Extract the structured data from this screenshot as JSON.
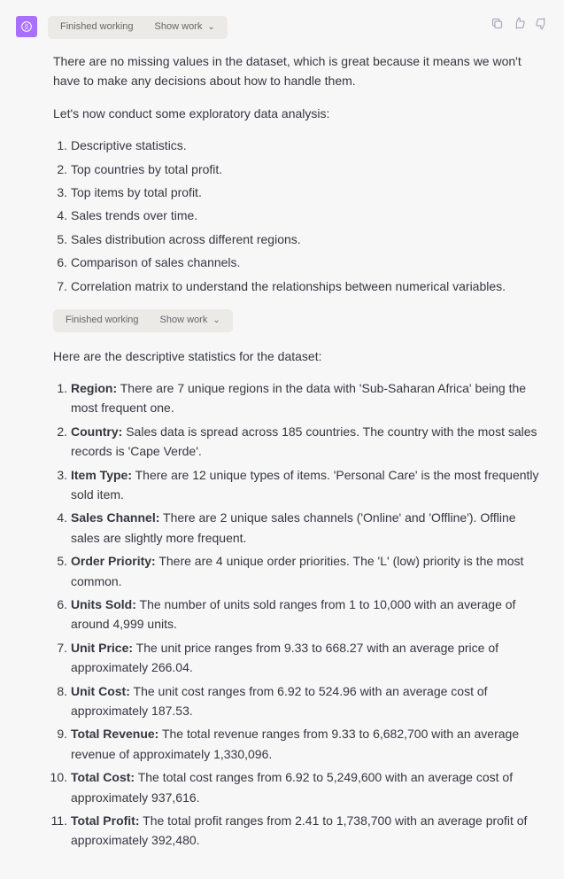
{
  "assistant": {
    "top_pill": {
      "status": "Finished working",
      "show_work": "Show work"
    },
    "paragraph1": "There are no missing values in the dataset, which is great because it means we won't have to make any decisions about how to handle them.",
    "paragraph2": "Let's now conduct some exploratory data analysis:",
    "eda_list": [
      "Descriptive statistics.",
      "Top countries by total profit.",
      "Top items by total profit.",
      "Sales trends over time.",
      "Sales distribution across different regions.",
      "Comparison of sales channels.",
      "Correlation matrix to understand the relationships between numerical variables."
    ],
    "mid_pill": {
      "status": "Finished working",
      "show_work": "Show work"
    },
    "paragraph3": "Here are the descriptive statistics for the dataset:",
    "desc_stats": [
      {
        "term": "Region:",
        "text": " There are 7 unique regions in the data with 'Sub-Saharan Africa' being the most frequent one."
      },
      {
        "term": "Country:",
        "text": " Sales data is spread across 185 countries. The country with the most sales records is 'Cape Verde'."
      },
      {
        "term": "Item Type:",
        "text": " There are 12 unique types of items. 'Personal Care' is the most frequently sold item."
      },
      {
        "term": "Sales Channel:",
        "text": " There are 2 unique sales channels ('Online' and 'Offline'). Offline sales are slightly more frequent."
      },
      {
        "term": "Order Priority:",
        "text": " There are 4 unique order priorities. The 'L' (low) priority is the most common."
      },
      {
        "term": "Units Sold:",
        "text": " The number of units sold ranges from 1 to 10,000 with an average of around 4,999 units."
      },
      {
        "term": "Unit Price:",
        "text": " The unit price ranges from 9.33 to 668.27 with an average price of approximately 266.04."
      },
      {
        "term": "Unit Cost:",
        "text": " The unit cost ranges from 6.92 to 524.96 with an average cost of approximately 187.53."
      },
      {
        "term": "Total Revenue:",
        "text": " The total revenue ranges from 9.33 to 6,682,700 with an average revenue of approximately 1,330,096."
      },
      {
        "term": "Total Cost:",
        "text": " The total cost ranges from 6.92 to 5,249,600 with an average cost of approximately 937,616."
      },
      {
        "term": "Total Profit:",
        "text": " The total profit ranges from 2.41 to 1,738,700 with an average profit of approximately 392,480."
      }
    ]
  }
}
